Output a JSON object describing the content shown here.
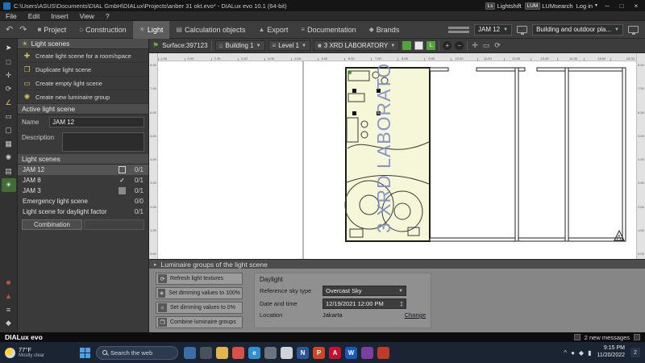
{
  "titlebar": {
    "title": "C:\\Users\\ASUS\\Documents\\DIAL GmbH\\DIALux\\Projects\\anber 31 okt.evo* - DIALux evo 10.1  (64-bit)",
    "lightshift_badge": "Ls",
    "lightshift": "Lightshift",
    "lum_badge": "LUM",
    "lumsearch": "LUMsearch",
    "login": "Log in",
    "minimize": "─",
    "maximize": "□",
    "close": "×"
  },
  "menubar": {
    "items": [
      "File",
      "Edit",
      "Insert",
      "View",
      "?"
    ]
  },
  "ribbon": {
    "undo": "↶",
    "redo": "↷",
    "tabs": [
      {
        "label": "Project",
        "icon": "■"
      },
      {
        "label": "Construction",
        "icon": "⌂"
      },
      {
        "label": "Light",
        "icon": "☀",
        "row_class": "active"
      },
      {
        "label": "Calculation objects",
        "icon": "▤"
      },
      {
        "label": "Export",
        "icon": "▲"
      },
      {
        "label": "Documentation",
        "icon": "≡"
      },
      {
        "label": "Brands",
        "icon": "◆"
      }
    ],
    "scene_select": "JAM 12",
    "mode_select": "Building and outdoor pla..."
  },
  "left_tools_top": [
    {
      "name": "pointer-tool-icon",
      "glyph": "➤",
      "color": "#e6e6e6"
    },
    {
      "name": "select-area-tool-icon",
      "glyph": "□",
      "color": "#c9c9c9"
    },
    {
      "name": "move-tool-icon",
      "glyph": "✛",
      "color": "#c9c9c9"
    },
    {
      "name": "rotate-tool-icon",
      "glyph": "⟳",
      "color": "#c9c9c9"
    },
    {
      "name": "measure-tool-icon",
      "glyph": "∠",
      "color": "#d8c25a"
    },
    {
      "name": "wall-tool-icon",
      "glyph": "▭",
      "color": "#c9c9c9"
    },
    {
      "name": "room-tool-icon",
      "glyph": "▢",
      "color": "#c9c9c9"
    },
    {
      "name": "furniture-tool-icon",
      "glyph": "▦",
      "color": "#c9c9c9"
    },
    {
      "name": "luminaire-tool-icon",
      "glyph": "✺",
      "color": "#c9c9c9"
    },
    {
      "name": "calculation-surface-tool-icon",
      "glyph": "▤",
      "color": "#c9c9c9"
    },
    {
      "name": "daylight-tool-icon",
      "glyph": "☀",
      "color": "#bfe3a0",
      "row_class": "active"
    }
  ],
  "left_tools_bottom": [
    {
      "name": "emergency-lighting-tool-icon",
      "glyph": "■",
      "color": "#c05548"
    },
    {
      "name": "marker-tool-icon",
      "glyph": "▲",
      "color": "#c05548"
    },
    {
      "name": "layers-tool-icon",
      "glyph": "≡",
      "color": "#c9c9c9"
    },
    {
      "name": "settings-tool-icon",
      "glyph": "◆",
      "color": "#c9c9c9"
    }
  ],
  "light_panel": {
    "title": "Light scenes",
    "actions": [
      {
        "label": "Create light scene for a room/space",
        "icon": "✚",
        "name": "create-light-scene-button"
      },
      {
        "label": "Duplicate light scene",
        "icon": "❐",
        "name": "duplicate-light-scene-button"
      },
      {
        "label": "Create empty light scene",
        "icon": "▭",
        "name": "create-empty-light-scene-button"
      },
      {
        "label": "Create new luminaire group",
        "icon": "✺",
        "name": "create-luminaire-group-button"
      }
    ],
    "active_header": "Active light scene",
    "name_label": "Name",
    "name_value": "JAM 12",
    "desc_label": "Description",
    "list_header": "Light scenes",
    "scenes": [
      {
        "name": "JAM 12",
        "count": "0/1",
        "cb": "cb-empty",
        "row_class": "selected"
      },
      {
        "name": "JAM 8",
        "count": "0/1",
        "cb": "cb-checked",
        "check": "✓"
      },
      {
        "name": "JAM 3",
        "count": "0/1",
        "cb": "cb-gray"
      },
      {
        "name": "Emergency light scene",
        "count": "0/0",
        "cb": "cb-none"
      },
      {
        "name": "Light scene for daylight factor",
        "count": "0/1",
        "cb": "cb-none"
      }
    ],
    "combination": "Combination"
  },
  "canvas_toolbar": {
    "surface_label": "Surface:397123",
    "building": "Building 1",
    "level": "Level 1",
    "space": "3 XRD LABORATORY"
  },
  "rulers": {
    "top": [
      "-1.00",
      "0.00",
      "1.00",
      "2.00",
      "3.00",
      "4.00",
      "5.00",
      "6.00",
      "7.00",
      "8.00",
      "9.00",
      "10.00",
      "11.00",
      "12.00",
      "13.00",
      "14.00",
      "15.00",
      "16.00"
    ],
    "left": [
      "8.00",
      "7.00",
      "6.00",
      "5.00",
      "4.00",
      "3.00",
      "2.00",
      "1.00",
      "0.00"
    ],
    "right": [
      "8.00",
      "7.00",
      "6.00",
      "5.00",
      "4.00",
      "3.00",
      "2.00",
      "1.00",
      "0.00"
    ]
  },
  "plan": {
    "room_label": "3 XRD LABORATORY",
    "marker": "A"
  },
  "bottom_panel": {
    "title": "Luminaire groups of the light scene",
    "buttons": [
      {
        "label": "Refresh light textures",
        "icon": "⟳",
        "name": "refresh-light-textures-button"
      },
      {
        "label": "Set dimming values to 100%",
        "icon": "☀",
        "name": "set-dimming-100-button"
      },
      {
        "label": "Set dimming values to 0%",
        "icon": "☼",
        "name": "set-dimming-0-button"
      },
      {
        "label": "Combine luminaire groups",
        "icon": "❐",
        "name": "combine-luminaire-groups-button"
      }
    ],
    "daylight": {
      "title": "Daylight",
      "sky_label": "Reference sky type",
      "sky_value": "Overcast Sky",
      "dt_label": "Date and time",
      "dt_value": "12/19/2021 12:00 PM",
      "loc_label": "Location",
      "loc_value": "Jakarta",
      "change": "Change"
    }
  },
  "statusbar": {
    "brand": "DIALux evo",
    "messages": "2 new messages"
  },
  "taskbar": {
    "weather_temp": "77°F",
    "weather_desc": "Mostly clear",
    "search_placeholder": "Search the web",
    "apps": [
      {
        "name": "app-icon-1",
        "color": "#3a6ea8"
      },
      {
        "name": "app-icon-2",
        "color": "#49515c"
      },
      {
        "name": "folder-icon",
        "color": "#e3b54d"
      },
      {
        "name": "chrome-icon",
        "color": "#d8504a"
      },
      {
        "name": "edge-icon",
        "color": "#2f8fd0",
        "letter": "e"
      },
      {
        "name": "app-icon-3",
        "color": "#6a7480"
      },
      {
        "name": "app-icon-4",
        "color": "#cfd3d8"
      },
      {
        "name": "notes-app-icon",
        "color": "#2b579a",
        "letter": "N"
      },
      {
        "name": "powerpoint-icon",
        "color": "#d04423",
        "letter": "P"
      },
      {
        "name": "acrobat-icon",
        "color": "#c8102e",
        "letter": "A"
      },
      {
        "name": "word-icon",
        "color": "#185abd",
        "letter": "W"
      },
      {
        "name": "app-icon-5",
        "color": "#7b3fa0"
      },
      {
        "name": "app-icon-6",
        "color": "#c0392b"
      }
    ],
    "time": "9:15 PM",
    "date": "11/20/2022"
  }
}
